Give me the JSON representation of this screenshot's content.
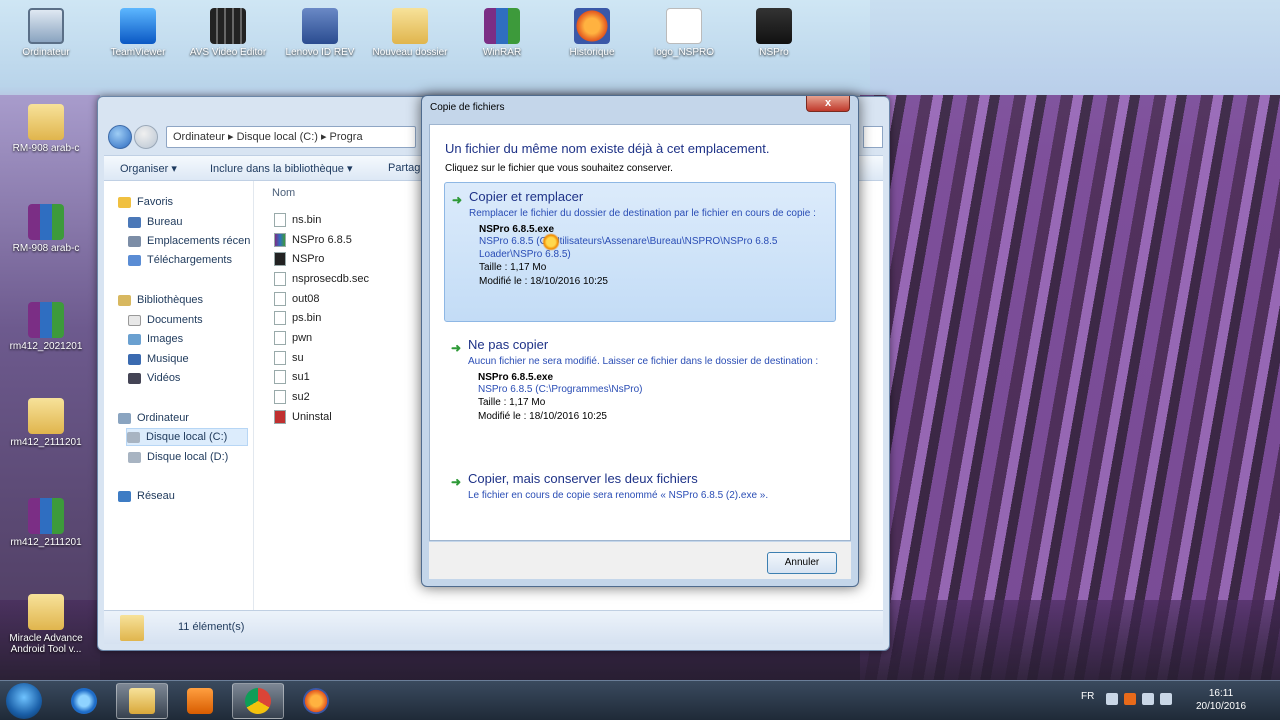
{
  "desktop": {
    "top_icons": [
      {
        "label": "Ordinateur",
        "icon": "computer-icon"
      },
      {
        "label": "TeamViewer",
        "icon": "teamviewer-icon"
      },
      {
        "label": "AVS Video Editor",
        "icon": "video-editor-icon"
      },
      {
        "label": "Lenovo ID REV",
        "icon": "lenovo-icon"
      },
      {
        "label": "Nouveau dossier",
        "icon": "folder-icon"
      },
      {
        "label": "WinRAR",
        "icon": "winrar-icon"
      },
      {
        "label": "Historique",
        "icon": "firefox-doc-icon"
      },
      {
        "label": "logo_NSPRO",
        "icon": "logo-icon"
      },
      {
        "label": "NSPro",
        "icon": "calculator-icon"
      }
    ],
    "left_icons": [
      {
        "label": "RM-908 arab-c",
        "icon": "folder-icon"
      },
      {
        "label": "RM-908 arab-c",
        "icon": "winrar-icon"
      },
      {
        "label": "rm412_2021201",
        "icon": "winrar-icon"
      },
      {
        "label": "rm412_2111201",
        "icon": "folder-icon"
      },
      {
        "label": "rm412_2111201",
        "icon": "winrar-icon"
      },
      {
        "label": "Miracle Advance Android Tool v...",
        "icon": "folder-icon"
      }
    ]
  },
  "explorer": {
    "address": "Ordinateur  ▸  Disque local (C:)  ▸  Progra",
    "toolbar": {
      "organize": "Organiser ▾",
      "include": "Inclure dans la bibliothèque ▾",
      "share": "Partag"
    },
    "nav": [
      {
        "label": "Favoris",
        "group": true
      },
      {
        "label": "Bureau"
      },
      {
        "label": "Emplacements récen"
      },
      {
        "label": "Téléchargements"
      },
      {
        "label": "Bibliothèques",
        "group": true
      },
      {
        "label": "Documents"
      },
      {
        "label": "Images"
      },
      {
        "label": "Musique"
      },
      {
        "label": "Vidéos"
      },
      {
        "label": "Ordinateur",
        "group": true
      },
      {
        "label": "Disque local (C:)",
        "selected": true
      },
      {
        "label": "Disque local (D:)"
      },
      {
        "label": "Réseau",
        "group": true
      }
    ],
    "column_header": "Nom",
    "files": [
      "ns.bin",
      "NSPro 6.8.5",
      "NSPro",
      "nsprosecdb.sec",
      "out08",
      "ps.bin",
      "pwn",
      "su",
      "su1",
      "su2",
      "Uninstal"
    ],
    "status": "11 élément(s)"
  },
  "dialog": {
    "title": "Copie de fichiers",
    "close": "x",
    "heading": "Un fichier du même nom existe déjà à cet emplacement.",
    "subheading": "Cliquez sur le fichier que vous souhaitez conserver.",
    "option1": {
      "title": "Copier et remplacer",
      "desc": "Remplacer le fichier du dossier de destination par le fichier en cours de copie :",
      "filename": "NSPro 6.8.5.exe",
      "path": "NSPro 6.8.5 (C:\\Utilisateurs\\Assenare\\Bureau\\NSPRO\\NSPro 6.8.5 Loader\\NSPro 6.8.5)",
      "size": "Taille : 1,17 Mo",
      "modified": "Modifié le : 18/10/2016 10:25"
    },
    "option2": {
      "title": "Ne pas copier",
      "desc": "Aucun fichier ne sera modifié. Laisser ce fichier dans le dossier de destination :",
      "filename": "NSPro 6.8.5.exe",
      "path": "NSPro 6.8.5 (C:\\Programmes\\NsPro)",
      "size": "Taille : 1,17 Mo",
      "modified": "Modifié le : 18/10/2016 10:25"
    },
    "option3": {
      "title": "Copier, mais conserver les deux fichiers",
      "desc": "Le fichier en cours de copie sera renommé « NSPro 6.8.5 (2).exe »."
    },
    "cancel": "Annuler"
  },
  "taskbar": {
    "lang": "FR",
    "time": "16:11",
    "date": "20/10/2016"
  }
}
